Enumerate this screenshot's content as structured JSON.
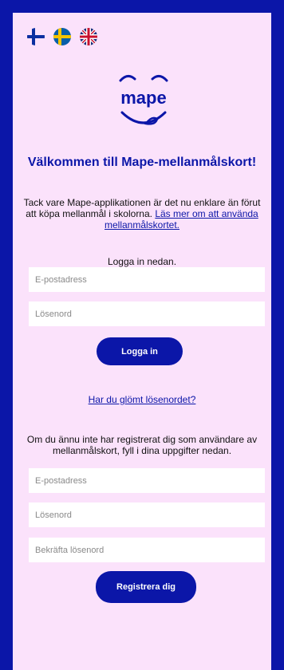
{
  "languages": [
    {
      "name": "Finnish"
    },
    {
      "name": "Swedish"
    },
    {
      "name": "English"
    }
  ],
  "brand": {
    "logo_text": "mape"
  },
  "welcome": {
    "title": "Välkommen till Mape-mellanmålskort!",
    "intro_text": "Tack vare Mape-applikationen är det nu enklare än förut att köpa mellanmål i skolorna. ",
    "intro_link": "Läs mer om att använda mellanmålskortet."
  },
  "login": {
    "prompt": "Logga in nedan.",
    "email_placeholder": "E-postadress",
    "password_placeholder": "Lösenord",
    "button_label": "Logga in",
    "forgot_link": "Har du glömt lösenordet?"
  },
  "register": {
    "prompt": "Om du ännu inte har registrerat dig som användare av mellanmålskort, fyll i dina uppgifter nedan.",
    "email_placeholder": "E-postadress",
    "password_placeholder": "Lösenord",
    "confirm_placeholder": "Bekräfta lösenord",
    "button_label": "Registrera dig"
  },
  "colors": {
    "brand_blue": "#0b16a8",
    "background_pink": "#fbe2fb"
  }
}
